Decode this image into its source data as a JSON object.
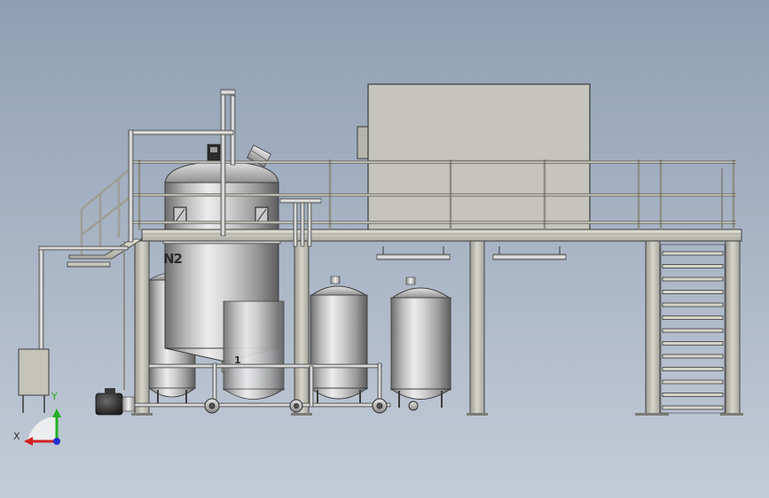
{
  "view": {
    "background_top": "#8f9fb3",
    "background_bottom": "#c3cbd7"
  },
  "tank_labels": {
    "main_tank_marking": "N2",
    "cone_marking": "1"
  },
  "triad": {
    "x_label": "X",
    "y_label": "Y",
    "x_color": "#d42020",
    "y_color": "#22b022",
    "z_color": "#2030d0"
  },
  "components": [
    "main-reactor-tank",
    "storage-tank-1",
    "storage-tank-2",
    "storage-tank-3",
    "rear-tank",
    "equipment-enclosure",
    "platform-deck",
    "platform-railing",
    "staircase-right",
    "ladder-left",
    "control-box",
    "pump-motor",
    "transfer-pumps",
    "piping"
  ]
}
